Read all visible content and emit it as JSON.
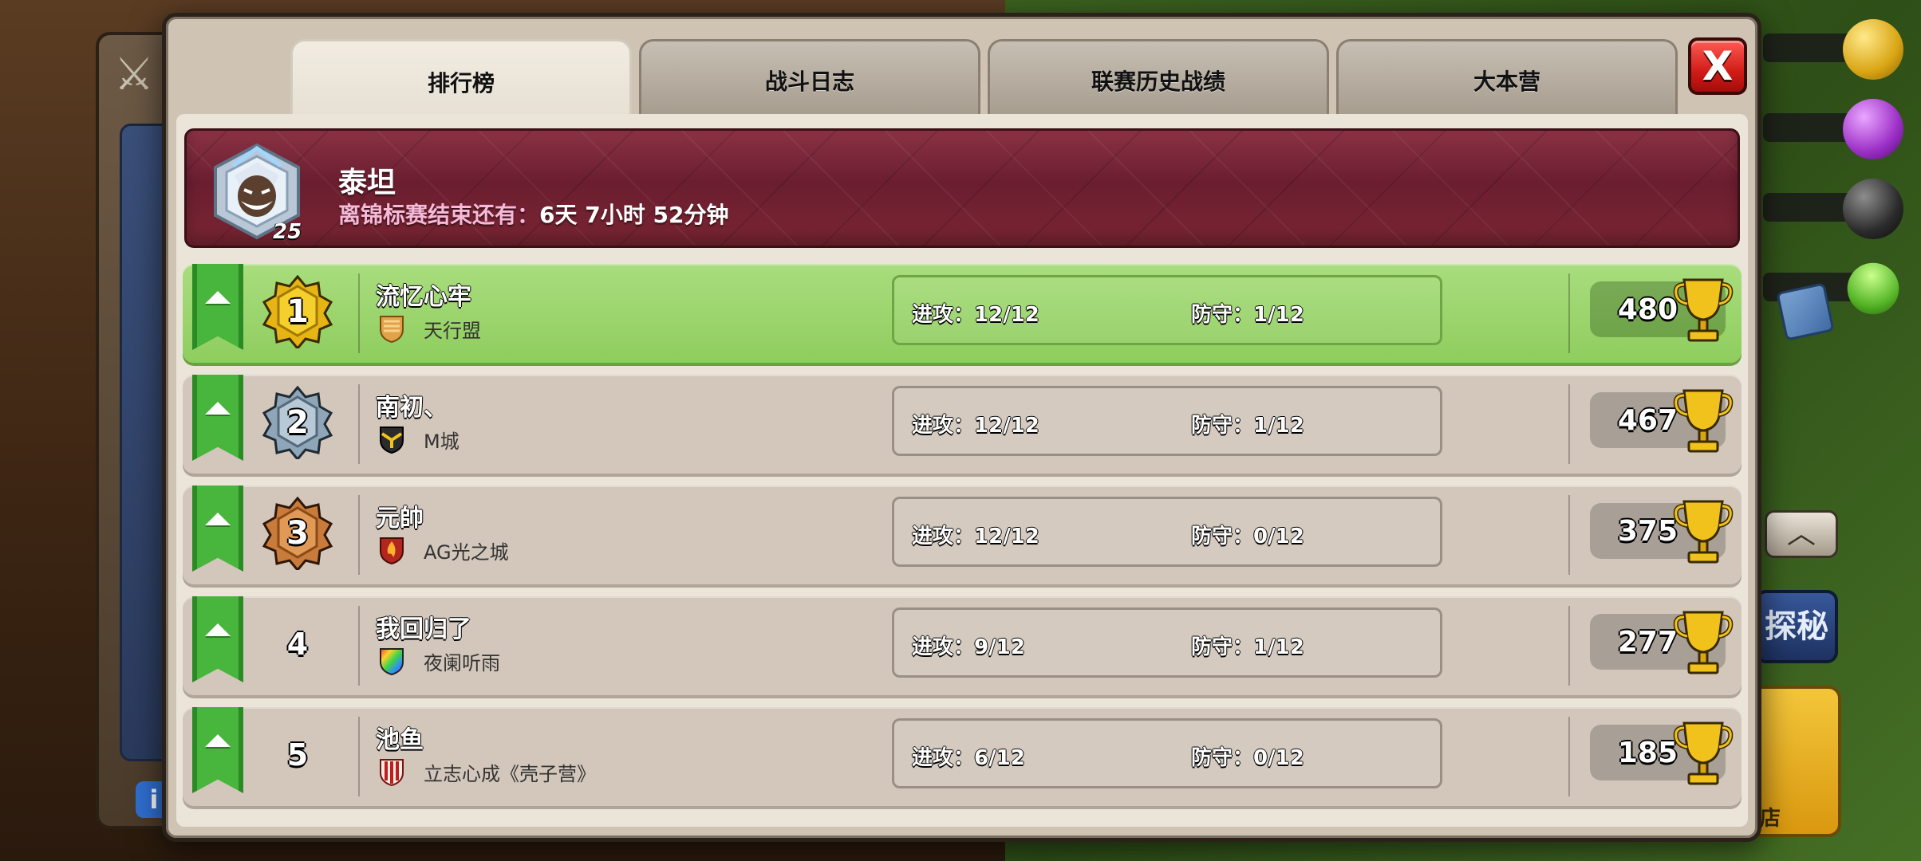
{
  "colors": {
    "highlight_row": "#98d46a",
    "normal_row": "#d3c7bc",
    "banner": "#7a2533",
    "close_button": "#e0261f",
    "ribbon": "#48b53c"
  },
  "tabs": [
    {
      "label": "排行榜",
      "active": true
    },
    {
      "label": "战斗日志",
      "active": false
    },
    {
      "label": "联赛历史战绩",
      "active": false
    },
    {
      "label": "大本营",
      "active": false
    }
  ],
  "close_label": "X",
  "league": {
    "name": "泰坦",
    "level": "25",
    "countdown_prefix": "离锦标赛结束还有：",
    "countdown_days": "6天",
    "countdown_hours": "7小时",
    "countdown_minutes": "52分钟",
    "badge_icon": "titan-league-icon"
  },
  "rankings": [
    {
      "rank": "1",
      "name": "流忆心牢",
      "clan": "天行盟",
      "attack_label": "进攻：",
      "attack": "12/12",
      "defense_label": "防守：",
      "defense": "1/12",
      "trophies": "480",
      "highlight": true
    },
    {
      "rank": "2",
      "name": "南初、",
      "clan": "M城",
      "attack_label": "进攻：",
      "attack": "12/12",
      "defense_label": "防守：",
      "defense": "1/12",
      "trophies": "467",
      "highlight": false
    },
    {
      "rank": "3",
      "name": "元帥",
      "clan": "AG光之城",
      "attack_label": "进攻：",
      "attack": "12/12",
      "defense_label": "防守：",
      "defense": "0/12",
      "trophies": "375",
      "highlight": false
    },
    {
      "rank": "4",
      "name": "我回归了",
      "clan": "夜阑听雨",
      "attack_label": "进攻：",
      "attack": "9/12",
      "defense_label": "防守：",
      "defense": "1/12",
      "trophies": "277",
      "highlight": false
    },
    {
      "rank": "5",
      "name": "池鱼",
      "clan": "立志心成《壳子营》",
      "attack_label": "进攻：",
      "attack": "6/12",
      "defense_label": "防守：",
      "defense": "0/12",
      "trophies": "185",
      "highlight": false
    }
  ],
  "background": {
    "explore_label": "探秘",
    "shop_label": "店",
    "info_label": "i"
  }
}
